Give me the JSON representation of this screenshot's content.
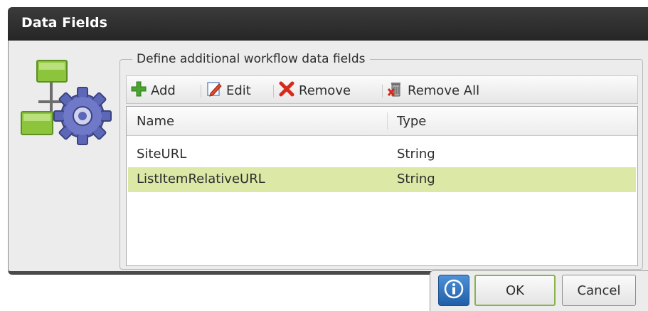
{
  "dialog": {
    "title": "Data Fields",
    "group_legend": "Define additional workflow data fields"
  },
  "toolbar": {
    "add_label": "Add",
    "edit_label": "Edit",
    "remove_label": "Remove",
    "remove_all_label": "Remove All"
  },
  "grid": {
    "columns": [
      "Name",
      "Type"
    ],
    "rows": [
      {
        "name": "SiteURL",
        "type": "String",
        "selected": false
      },
      {
        "name": "ListItemRelativeURL",
        "type": "String",
        "selected": true
      }
    ]
  },
  "buttons": {
    "ok_label": "OK",
    "cancel_label": "Cancel"
  },
  "colors": {
    "selected_row": "#dbe8a6",
    "titlebar": "#2b2b2b",
    "add_icon": "#4aa52e",
    "remove_icon": "#d62a1c",
    "info_button": "#2f72bf"
  },
  "icons": {
    "header": "workflow-gear-icon",
    "add": "green-plus-icon",
    "edit": "pencil-icon",
    "remove": "red-x-icon",
    "remove_all": "trash-can-icon",
    "info": "info-icon"
  }
}
